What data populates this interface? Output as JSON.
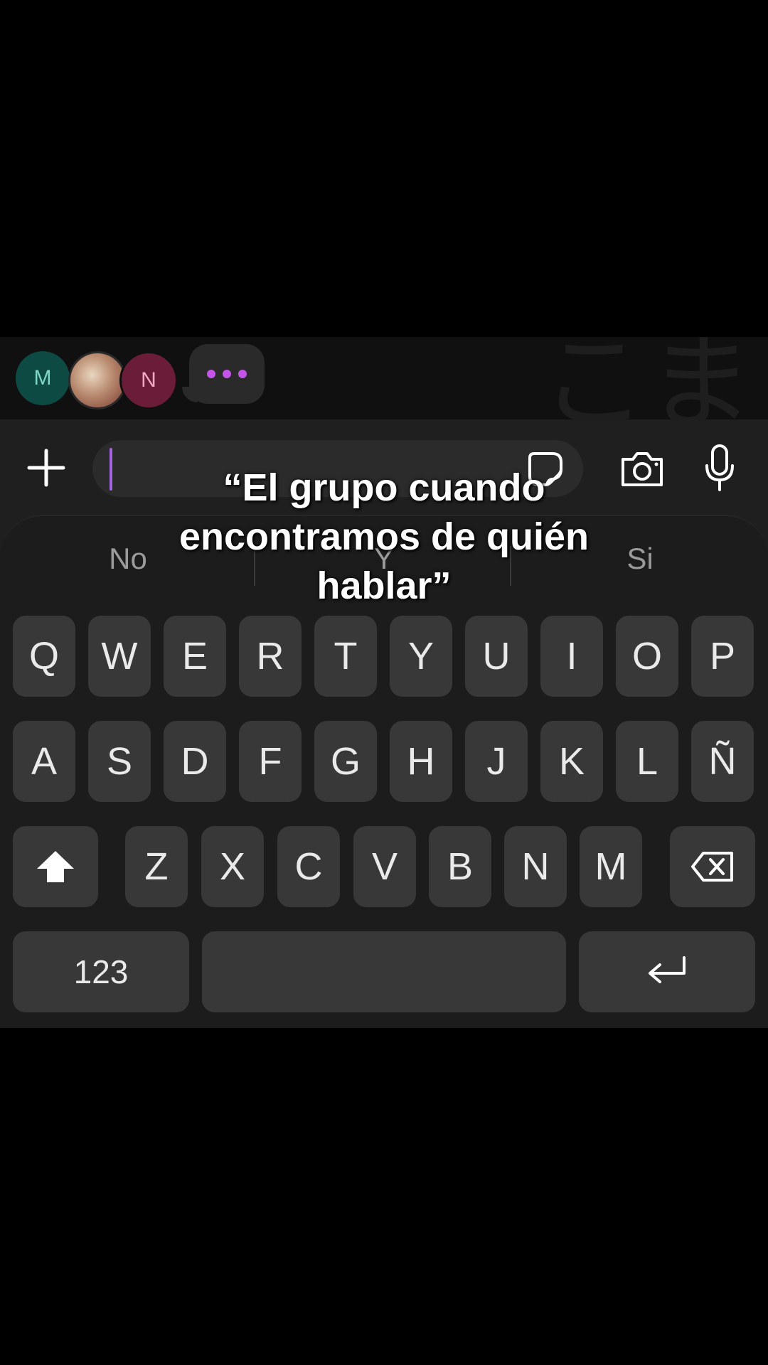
{
  "chat": {
    "avatars": [
      {
        "initial": "M",
        "color": "#0d4a44"
      },
      {
        "initial": "",
        "kind": "photo"
      },
      {
        "initial": "N",
        "color": "#6a1c38"
      }
    ],
    "typing_indicator_icon": "three-dots-icon"
  },
  "composer": {
    "add_icon": "plus-icon",
    "sticker_icon": "sticker-icon",
    "camera_icon": "camera-icon",
    "mic_icon": "microphone-icon",
    "cursor_color": "#a465e0"
  },
  "suggestions": [
    "No",
    "Y",
    "Si"
  ],
  "keyboard": {
    "row1": [
      "Q",
      "W",
      "E",
      "R",
      "T",
      "Y",
      "U",
      "I",
      "O",
      "P"
    ],
    "row2": [
      "A",
      "S",
      "D",
      "F",
      "G",
      "H",
      "J",
      "K",
      "L",
      "Ñ"
    ],
    "row3": [
      "Z",
      "X",
      "C",
      "V",
      "B",
      "N",
      "M"
    ],
    "numbers_label": "123",
    "shift_icon": "shift-arrow-icon",
    "backspace_icon": "backspace-icon",
    "enter_icon": "enter-return-icon"
  },
  "caption": "“El grupo cuando encontramos de quién hablar”"
}
